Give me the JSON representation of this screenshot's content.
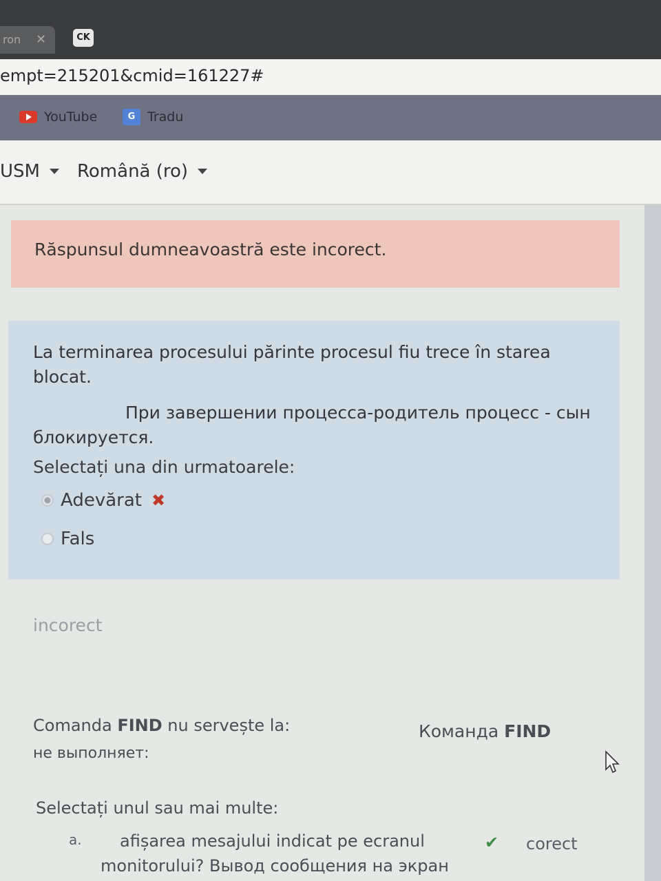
{
  "browser": {
    "tabs": [
      {
        "label": "ron"
      },
      {
        "label": "CK"
      }
    ],
    "url": "empt=215201&cmid=161227#",
    "bookmarks": [
      {
        "label": "YouTube",
        "icon": "youtube-icon"
      },
      {
        "label": "Tradu",
        "icon": "translate-icon"
      }
    ]
  },
  "site_nav": {
    "items": [
      {
        "label": "USM"
      },
      {
        "label": "Română (ro)"
      }
    ]
  },
  "question1": {
    "alert": "Răspunsul dumneavoastră este incorect.",
    "text_ro": "La terminarea procesului părinte procesul fiu  trece în starea  blocat.",
    "text_ru": "При завершении процесса-родитель процесс - сын блокируется.",
    "prompt": "Selectați una din urmatoarele:",
    "options": [
      {
        "label": "Adevărat",
        "selected": true,
        "mark": "✖"
      },
      {
        "label": "Fals",
        "selected": false
      }
    ],
    "feedback": "incorect"
  },
  "question2": {
    "text_ro_prefix": "Comanda ",
    "text_ro_keyword": "FIND",
    "text_ro_suffix": " nu servește la:",
    "text_ru_prefix": "Команда ",
    "text_ru_keyword": "FIND",
    "text_ru_line2": "не выполняет:",
    "prompt": "Selectați unul sau mai multe:",
    "options": [
      {
        "letter": "a.",
        "text_line1": "afișarea mesajului indicat pe ecranul",
        "text_line2": "monitorului?   Вывод сообщения на экран",
        "mark": "✔",
        "status": "corect"
      }
    ]
  },
  "colors": {
    "alert_bg": "#efc6bc",
    "question_bg": "#cfdbe5",
    "incorrect_mark": "#c0392b",
    "correct_mark": "#3f8f4a"
  }
}
